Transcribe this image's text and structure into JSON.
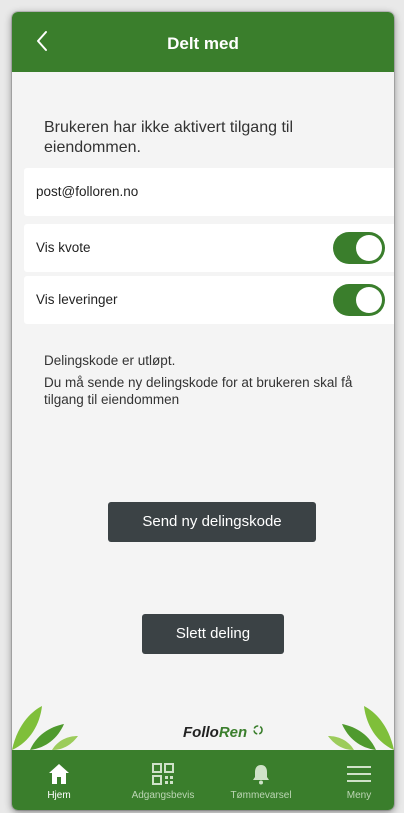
{
  "header": {
    "title": "Delt med"
  },
  "info": {
    "text": "Brukeren har ikke aktivert tilgang til eiendommen."
  },
  "email": {
    "value": "post@folloren.no"
  },
  "toggles": [
    {
      "label": "Vis kvote",
      "on": true
    },
    {
      "label": "Vis leveringer",
      "on": true
    }
  ],
  "status": {
    "expired": "Delingskode er utløpt.",
    "message": "Du må sende ny delingskode for at brukeren skal få tilgang til eiendommen"
  },
  "buttons": {
    "send": "Send ny delingskode",
    "delete": "Slett deling"
  },
  "brand": {
    "part1": "Follo",
    "part2": "Ren"
  },
  "tabs": [
    {
      "label": "Hjem",
      "icon": "home-icon",
      "active": true
    },
    {
      "label": "Adgangsbevis",
      "icon": "qr-code-icon",
      "active": false
    },
    {
      "label": "Tømmevarsel",
      "icon": "bell-icon",
      "active": false
    },
    {
      "label": "Meny",
      "icon": "menu-icon",
      "active": false
    }
  ],
  "colors": {
    "primary": "#3a7e2c",
    "button": "#3b4245"
  }
}
